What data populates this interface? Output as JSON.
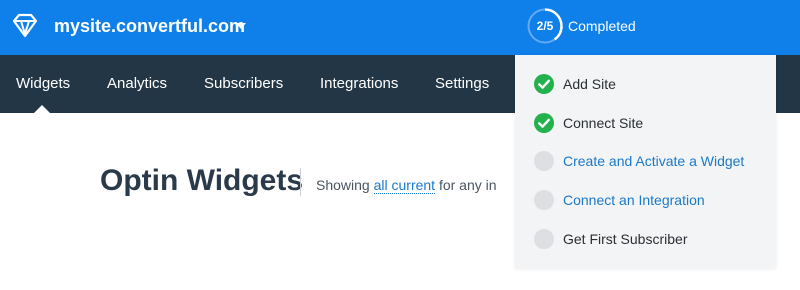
{
  "header": {
    "logo_icon": "diamond-logo-icon",
    "site_name": "mysite.convertful.com",
    "site_caret_icon": "caret-down-icon",
    "progress": {
      "text": "2/5",
      "completed_steps": 2,
      "total_steps": 5
    },
    "progress_label": "Completed",
    "colors": {
      "bar": "#0f7fea",
      "text": "#ffffff"
    }
  },
  "nav": {
    "items": [
      {
        "label": "Widgets",
        "active": true
      },
      {
        "label": "Analytics"
      },
      {
        "label": "Subscribers"
      },
      {
        "label": "Integrations"
      },
      {
        "label": "Settings"
      }
    ],
    "colors": {
      "bar": "#233645",
      "text": "#ffffff"
    }
  },
  "main": {
    "title": "Optin Widgets",
    "showing_prefix": "Showing",
    "filter_link": "all current",
    "showing_suffix": "for any in"
  },
  "checklist": {
    "items": [
      {
        "label": "Add Site",
        "done": true,
        "icon": "check-circle-icon"
      },
      {
        "label": "Connect Site",
        "done": true,
        "icon": "check-circle-icon"
      },
      {
        "label": "Create and Activate a Widget",
        "done": false,
        "icon": "empty-circle-icon"
      },
      {
        "label": "Connect an Integration",
        "done": false,
        "icon": "empty-circle-icon"
      },
      {
        "label": "Get First Subscriber",
        "done": false,
        "icon": "empty-circle-icon"
      }
    ],
    "colors": {
      "done": "#22b14c",
      "todo": "#dddfe2",
      "link": "#1b79c9"
    }
  }
}
